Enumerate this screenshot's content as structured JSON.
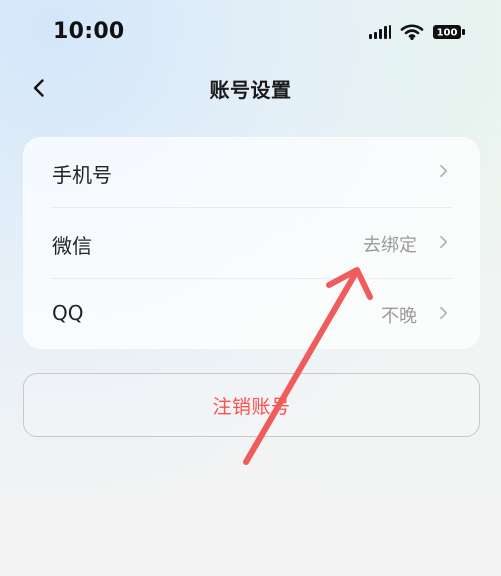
{
  "status_bar": {
    "time": "10:00",
    "battery": "100",
    "icons": [
      "signal-icon",
      "wifi-icon",
      "battery-icon"
    ]
  },
  "nav": {
    "title": "账号设置",
    "back_icon": "chevron-left-icon"
  },
  "settings": {
    "items": [
      {
        "label": "手机号",
        "value": ""
      },
      {
        "label": "微信",
        "value": "去绑定"
      },
      {
        "label": "QQ",
        "value": "不晚"
      }
    ]
  },
  "actions": {
    "logout_label": "注销账号"
  },
  "colors": {
    "accent_red": "#ff4f4f",
    "arrow_red": "#f05b5b",
    "text_primary": "#222222",
    "text_secondary": "#9b9b9b",
    "card_bg": "#ffffff"
  }
}
